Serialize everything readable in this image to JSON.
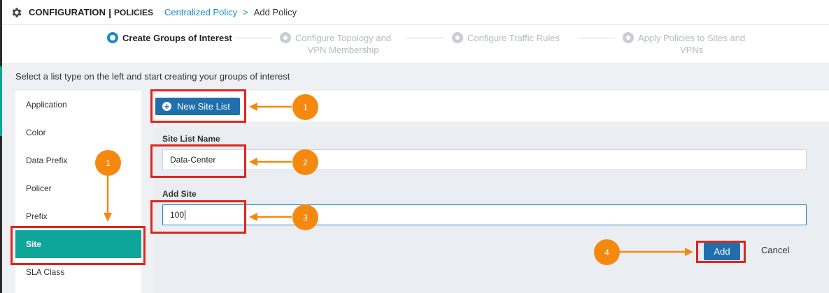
{
  "header": {
    "title": "CONFIGURATION",
    "separator": "|",
    "section": "POLICIES",
    "breadcrumb_link": "Centralized Policy",
    "breadcrumb_arrow": ">",
    "breadcrumb_current": "Add Policy"
  },
  "steps": [
    {
      "line1": "Create Groups of Interest",
      "line2": "",
      "state": "active"
    },
    {
      "line1": "Configure Topology and",
      "line2": "VPN Membership",
      "state": "inactive"
    },
    {
      "line1": "Configure Traffic Rules",
      "line2": "",
      "state": "inactive"
    },
    {
      "line1": "Apply Policies to Sites and",
      "line2": "VPNs",
      "state": "inactive"
    }
  ],
  "instruction": "Select a list type on the left and start creating your groups of interest",
  "sidebar": {
    "items": [
      {
        "label": "Application"
      },
      {
        "label": "Color"
      },
      {
        "label": "Data Prefix"
      },
      {
        "label": "Policer"
      },
      {
        "label": "Prefix"
      },
      {
        "label": "Site",
        "active": true
      },
      {
        "label": "SLA Class"
      }
    ]
  },
  "new_button": {
    "icon": "plus-circle-icon",
    "label": "New Site List"
  },
  "form": {
    "site_list_name_label": "Site List Name",
    "site_list_name_value": "Data-Center",
    "add_site_label": "Add Site",
    "add_site_value": "100",
    "add_button": "Add",
    "cancel_button": "Cancel"
  },
  "annotations": {
    "badge_new_list": "1",
    "badge_sidebar": "1",
    "badge_name": "2",
    "badge_site": "3",
    "badge_add": "4"
  },
  "colors": {
    "accent_blue": "#1a8bc6",
    "button_blue": "#1f6fad",
    "teal": "#0fa59a",
    "annotation_red": "#e0251c",
    "annotation_orange": "#f5890f"
  }
}
